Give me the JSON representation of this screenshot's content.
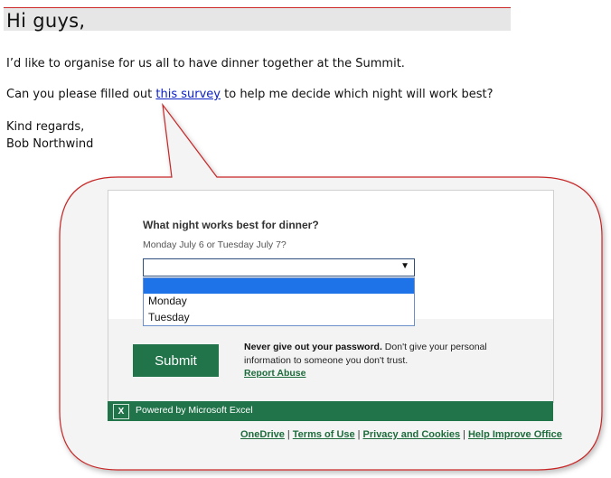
{
  "email": {
    "greeting": "Hi guys,",
    "line1": "I’d like to organise for us all to have dinner together at the Summit.",
    "line2_before": "Can you please filled out ",
    "line2_link": "this survey",
    "line2_after": " to help me decide which night will work best?",
    "signoff": "Kind regards,",
    "signature": "Bob Northwind"
  },
  "form": {
    "question": "What night works best for dinner?",
    "subtitle": "Monday July 6 or Tuesday July 7?",
    "selected_value": "",
    "options": [
      "",
      "Monday",
      "Tuesday"
    ],
    "submit_label": "Submit",
    "password_warning_bold": "Never give out your password.",
    "password_warning_rest": " Don't give your personal information to someone you don't trust.",
    "report_abuse": "Report Abuse"
  },
  "powered_by": {
    "icon_letter": "X",
    "text": "Powered by Microsoft Excel"
  },
  "footer": {
    "links": [
      "OneDrive",
      "Terms of Use",
      "Privacy and Cookies",
      "Help Improve Office"
    ],
    "separator": "|"
  },
  "colors": {
    "callout_border": "#c62828",
    "excel_green": "#21744a",
    "link_blue": "#0b20c6",
    "dropdown_highlight": "#1e73e8"
  }
}
